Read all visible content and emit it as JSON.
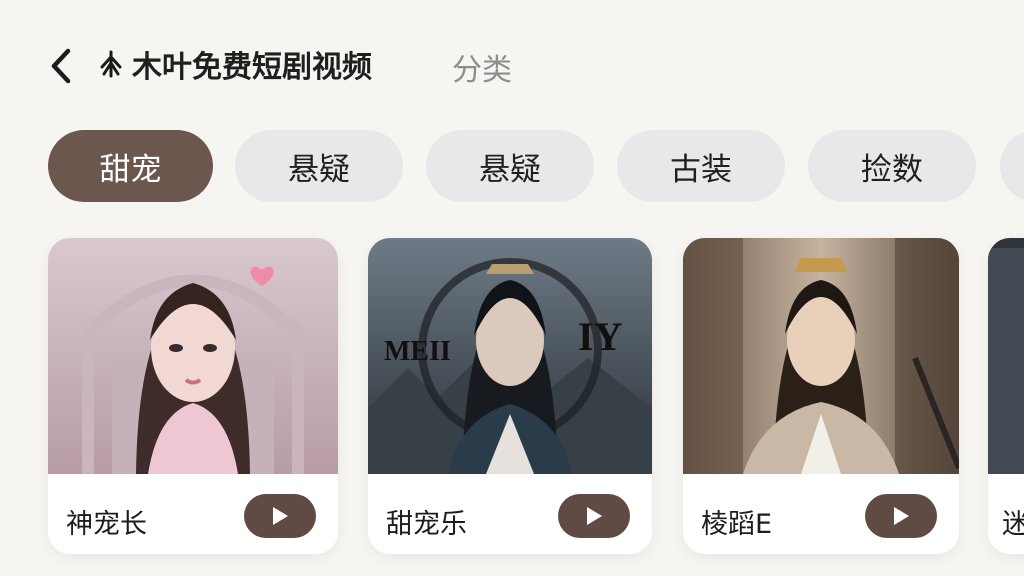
{
  "header": {
    "title": "木叶免费短剧视频",
    "category_tab": "分类"
  },
  "chips": [
    {
      "label": "甜宠",
      "active": true
    },
    {
      "label": "悬疑",
      "active": false
    },
    {
      "label": "悬疑",
      "active": false
    },
    {
      "label": "古装",
      "active": false
    },
    {
      "label": "捡数",
      "active": false
    }
  ],
  "cards": [
    {
      "title": "神宠长",
      "poster_text_left": "",
      "poster_text_right": ""
    },
    {
      "title": "甜宠乐",
      "poster_text_left": "MEII",
      "poster_text_right": "IY"
    },
    {
      "title": "棱蹈E",
      "poster_text_left": "",
      "poster_text_right": ""
    },
    {
      "title": "迷",
      "poster_text_left": "",
      "poster_text_right": ""
    }
  ],
  "colors": {
    "accent": "#6b574d",
    "play_button": "#5f4b43",
    "background": "#f7f5f2",
    "chip_inactive": "#e7e8ea"
  },
  "icons": {
    "back": "back-arrow-icon",
    "logo": "tree-logo-icon",
    "play": "play-icon"
  }
}
